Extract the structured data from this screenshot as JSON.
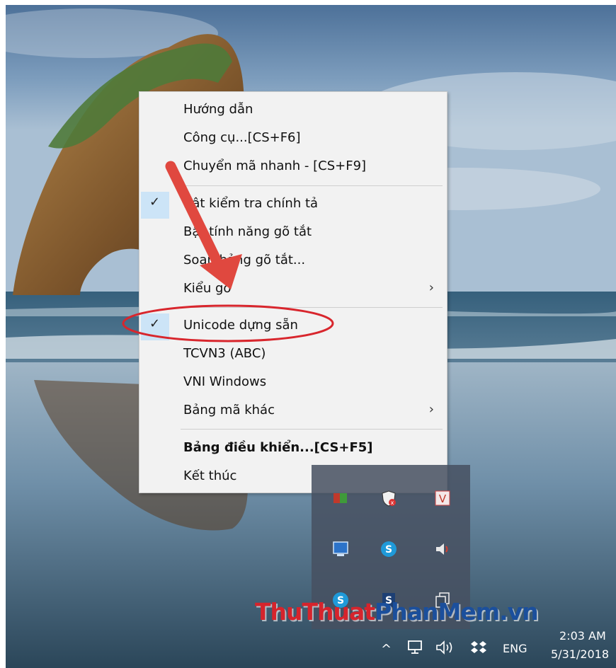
{
  "menu": {
    "items": [
      {
        "label": "Hướng dẫn",
        "checked": false,
        "submenu": false,
        "bold": false
      },
      {
        "label": "Công cụ...[CS+F6]",
        "checked": false,
        "submenu": false,
        "bold": false
      },
      {
        "label": "Chuyển mã nhanh - [CS+F9]",
        "checked": false,
        "submenu": false,
        "bold": false
      },
      {
        "label": "Bật kiểm tra chính tả",
        "checked": true,
        "submenu": false,
        "bold": false
      },
      {
        "label": "Bật tính năng gõ tắt",
        "checked": false,
        "submenu": false,
        "bold": false
      },
      {
        "label": "Soạn bảng gõ tắt...",
        "checked": false,
        "submenu": false,
        "bold": false
      },
      {
        "label": "Kiểu gõ",
        "checked": false,
        "submenu": true,
        "bold": false
      },
      {
        "label": "Unicode dựng sẵn",
        "checked": true,
        "submenu": false,
        "bold": false
      },
      {
        "label": "TCVN3 (ABC)",
        "checked": false,
        "submenu": false,
        "bold": false
      },
      {
        "label": "VNI Windows",
        "checked": false,
        "submenu": false,
        "bold": false
      },
      {
        "label": "Bảng mã khác",
        "checked": false,
        "submenu": true,
        "bold": false
      },
      {
        "label": "Bảng điều khiển...[CS+F5]",
        "checked": false,
        "submenu": false,
        "bold": true
      },
      {
        "label": "Kết thúc",
        "checked": false,
        "submenu": false,
        "bold": false
      }
    ],
    "check_glyph": "✓",
    "submenu_glyph": "›"
  },
  "annotation": {
    "arrow_color": "#e0483f",
    "highlight_ellipse_color": "#d8262d",
    "highlighted_item": "Unicode dựng sẵn"
  },
  "tray_popup": {
    "icons": [
      "vietkey-icon",
      "shield-x-icon",
      "v-icon",
      "network-monitor-icon",
      "skype-icon",
      "speaker-icon",
      "skype-icon",
      "skype-business-icon",
      "copy-icon"
    ]
  },
  "watermark": {
    "part1": "Thu",
    "part2": "Thuat",
    "part3": "PhanMem",
    "part4": ".vn",
    "color_red": "#d6242c",
    "color_blue": "#1b4f9c"
  },
  "taskbar": {
    "chevron": "^",
    "language": "ENG",
    "time": "2:03 AM",
    "date": "5/31/2018"
  }
}
